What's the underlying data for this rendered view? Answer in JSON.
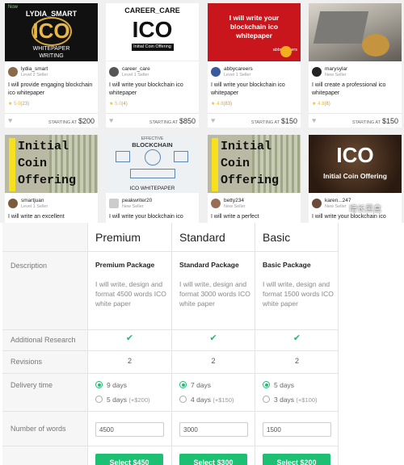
{
  "gigs": [
    {
      "thumb_lines": [
        "LYDIA_SMART",
        "ICO",
        "WHITEPAPER",
        "WRITING"
      ],
      "badge": "Now",
      "seller": "lydia_smart",
      "level": "Level 2 Seller",
      "title": "I will provide engaging blockchain ico whitepaper",
      "rating": "5.0",
      "reviews": "(23)",
      "starting": "STARTING AT",
      "price": "$200"
    },
    {
      "thumb_lines": [
        "CAREER_CARE",
        "ICO",
        "Initial Coin Offering"
      ],
      "seller": "career_care",
      "level": "Level 1 Seller",
      "title": "I will write your blockchain ico whitepaper",
      "rating": "5.0",
      "reviews": "(4)",
      "starting": "STARTING AT",
      "price": "$850"
    },
    {
      "thumb_lines": [
        "I will write your",
        "blockchain ico",
        "whitepaper",
        "abbycareers"
      ],
      "seller": "abbycareers",
      "level": "Level 1 Seller",
      "title": "I will write your blockchain ico whitepaper",
      "rating": "4.8",
      "reviews": "(83)",
      "starting": "STARTING AT",
      "price": "$150"
    },
    {
      "thumb_lines": [],
      "seller": "marysylar",
      "level": "New Seller",
      "title": "I will create a professional ico whitepaper",
      "rating": "4.8",
      "reviews": "(8)",
      "starting": "STARTING AT",
      "price": "$150"
    },
    {
      "thumb_lines": [
        "Initial",
        "Coin",
        "Offering"
      ],
      "seller": "smartjuan",
      "level": "Level 1 Seller",
      "title": "I will write an excellent"
    },
    {
      "thumb_lines": [
        "EFFECTIVE",
        "BLOCKCHAIN",
        "ICO WHITEPAPER"
      ],
      "seller": "peakwriter20",
      "level": "New Seller",
      "title": "I will write your blockchain ico"
    },
    {
      "thumb_lines": [
        "Initial",
        "Coin",
        "Offering"
      ],
      "seller": "betty234",
      "level": "New Seller",
      "title": "I will write a perfect"
    },
    {
      "thumb_lines": [
        "ICO",
        "Initial Coin Offering"
      ],
      "seller": "karen...247",
      "level": "New Seller",
      "title": "I will write your blockchain ico"
    }
  ],
  "table": {
    "packages": [
      {
        "name": "Premium",
        "title": "Premium Package",
        "desc": "I will write, design and format 4500 words ICO white paper",
        "revisions": "2",
        "delivery_a": "9 days",
        "delivery_b": "5 days",
        "delivery_b_extra": "(+$200)",
        "words": "4500",
        "button": "Select $450"
      },
      {
        "name": "Standard",
        "title": "Standard Package",
        "desc": "I will write, design and format 3000 words ICO white paper",
        "revisions": "2",
        "delivery_a": "7 days",
        "delivery_b": "4 days",
        "delivery_b_extra": "(+$150)",
        "words": "3000",
        "button": "Select $300"
      },
      {
        "name": "Basic",
        "title": "Basic Package",
        "desc": "I will write, design and format 1500 words ICO white paper",
        "revisions": "2",
        "delivery_a": "5 days",
        "delivery_b": "3 days",
        "delivery_b_extra": "(+$100)",
        "words": "1500",
        "button": "Select $200"
      }
    ],
    "labels": {
      "description": "Description",
      "additional_research": "Additional Research",
      "revisions": "Revisions",
      "delivery_time": "Delivery time",
      "number_of_words": "Number of words"
    },
    "check_glyph": "✔"
  },
  "watermark": "增长黑盒",
  "colors": {
    "accent": "#1dbf73",
    "star": "#f6b72a"
  }
}
